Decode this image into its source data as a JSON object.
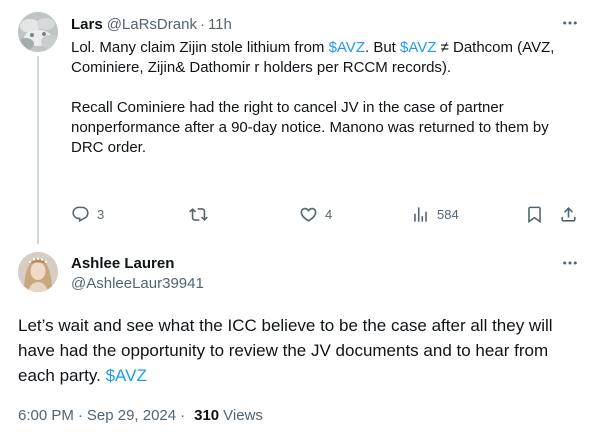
{
  "colors": {
    "text_primary": "#0f1419",
    "text_secondary": "#536471",
    "accent_link": "#1d9bf0",
    "thread_line": "#cfd9de"
  },
  "reply": {
    "author_name": "Lars",
    "author_handle": "@LaRsDrank",
    "separator": "·",
    "time": "11h",
    "more_icon": "more-horizontal-icon",
    "body": {
      "p1_a": "Lol. Many claim Zijin stole lithium from ",
      "p1_tag1": "$AVZ",
      "p1_b": ". But ",
      "p1_tag2": "$AVZ",
      "p1_c": " ≠ Dathcom (AVZ, Cominiere, Zijin& Dathomir r holders per RCCM records).",
      "p2": "Recall Cominiere had the right to cancel JV in the case of partner nonperformance after a 90-day notice. Manono was returned to them by DRC order."
    },
    "actions": {
      "replies": "3",
      "reposts": "",
      "likes": "4",
      "views": "584"
    }
  },
  "main": {
    "author_name": "Ashlee Lauren",
    "author_handle": "@AshleeLaur39941",
    "more_icon": "more-horizontal-icon",
    "body_text": "Let’s wait and see what the ICC believe to be the case after all they will have had the opportunity to review the JV documents and to hear from each party. ",
    "body_tag": "$AVZ",
    "time": "6:00 PM",
    "separator": "·",
    "date": "Sep 29, 2024",
    "views_count": "310",
    "views_label": "Views"
  }
}
